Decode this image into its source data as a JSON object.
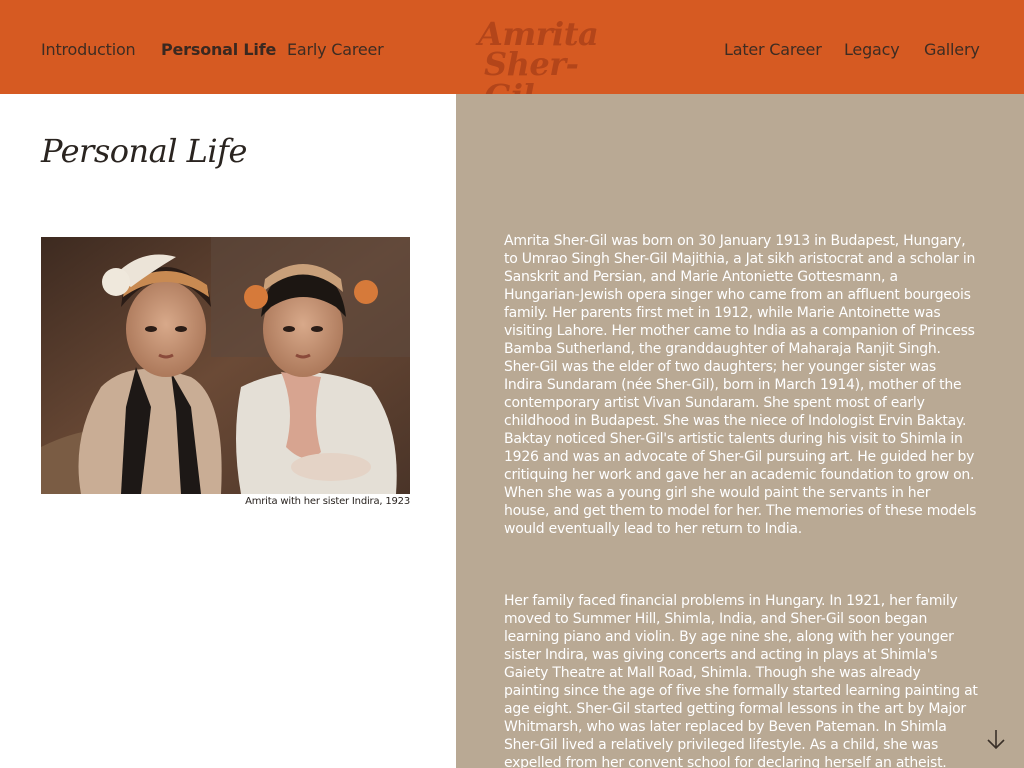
{
  "nav": {
    "left_items": [
      {
        "label": "Introduction",
        "active": false
      },
      {
        "label": "Personal Life",
        "active": true
      },
      {
        "label": "Early Career",
        "active": false
      }
    ],
    "right_items": [
      {
        "label": "Later Career",
        "active": false
      },
      {
        "label": "Legacy",
        "active": false
      },
      {
        "label": "Gallery",
        "active": false
      }
    ]
  },
  "logo": {
    "line1": "Amrita",
    "line2": "Sher-Gil"
  },
  "page": {
    "title": "Personal Life",
    "photo_caption": "Amrita with her sister Indira, 1923"
  },
  "content": {
    "paragraphs": [
      "Amrita Sher-Gil was born on 30 January 1913 in Budapest, Hungary, to Umrao Singh Sher-Gil Majithia, a Jat sikh aristocrat and a scholar in Sanskrit and Persian, and Marie Antoniette Gottesmann, a Hungarian-Jewish opera singer who came from an affluent bourgeois family. Her parents first met in 1912, while Marie Antoinette was visiting Lahore. Her mother came to India as a companion of Princess Bamba Sutherland, the granddaughter of Maharaja Ranjit Singh. Sher-Gil was the elder of two daughters; her younger sister was Indira Sundaram (née Sher-Gil), born in March 1914), mother of the contemporary artist Vivan Sundaram. She spent most of early childhood in Budapest. She was the niece of Indologist Ervin Baktay. Baktay noticed Sher-Gil's artistic talents during his visit to Shimla in 1926 and was an advocate of Sher-Gil pursuing art. He guided her by critiquing her work and gave her an academic foundation to grow on. When she was a young girl she would paint the servants in her house, and get them to model for her. The memories of these models would eventually lead to her return to India.",
      "Her family faced financial problems in Hungary. In 1921, her family moved to Summer Hill, Shimla, India, and Sher-Gil soon began learning piano and violin. By age nine she, along with her younger sister Indira, was giving concerts and acting in plays at Shimla's Gaiety Theatre at Mall Road, Shimla. Though she was already painting since the age of five she formally started learning painting at age eight. Sher-Gil started getting formal lessons in the art by Major Whitmarsh, who was later replaced by Beven Pateman. In Shimla Sher-Gil lived a relatively privileged lifestyle. As a child, she was expelled from her convent school for declaring herself an atheist."
    ]
  },
  "colors": {
    "nav_bg": "#d65a22",
    "logo": "#b3451a",
    "panel_bg": "#b9a994",
    "body_text": "#ffffff"
  },
  "icons": {
    "scroll": "arrow-down-icon"
  }
}
